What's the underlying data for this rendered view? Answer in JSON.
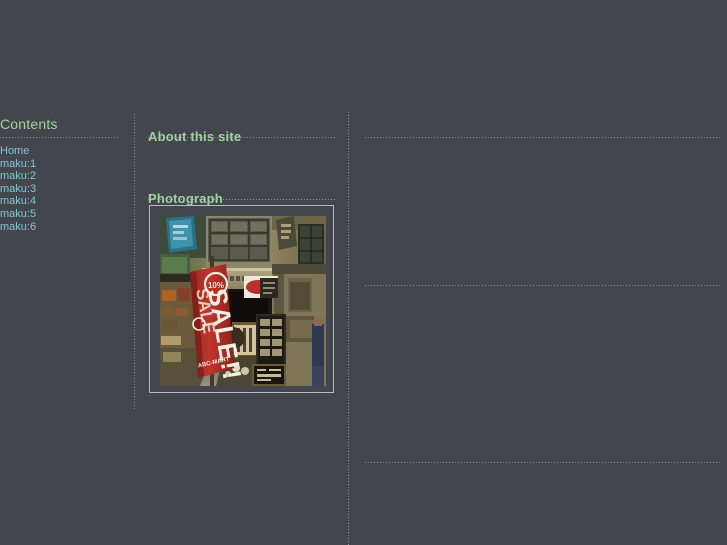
{
  "page": {
    "background_color": "#43474d",
    "heading_color": "#9fd4a0",
    "link_color": "#7ec6d8",
    "rule_color": "#aaafb4"
  },
  "sidebar": {
    "title": "Contents",
    "items": [
      {
        "label": "Home"
      },
      {
        "label": "maku:1"
      },
      {
        "label": "maku:2"
      },
      {
        "label": "maku:3"
      },
      {
        "label": "maku:4"
      },
      {
        "label": "maku:5"
      },
      {
        "label": "maku:6"
      }
    ]
  },
  "main": {
    "about_heading": "About this site",
    "photograph_heading": "Photograph",
    "photograph": {
      "alt": "Japanese shopping street storefront with a large red vertical SALE banner",
      "banner_text": "SALE!!",
      "banner_sub_text": "ABC-MART",
      "banner_color": "#b5312a"
    }
  }
}
